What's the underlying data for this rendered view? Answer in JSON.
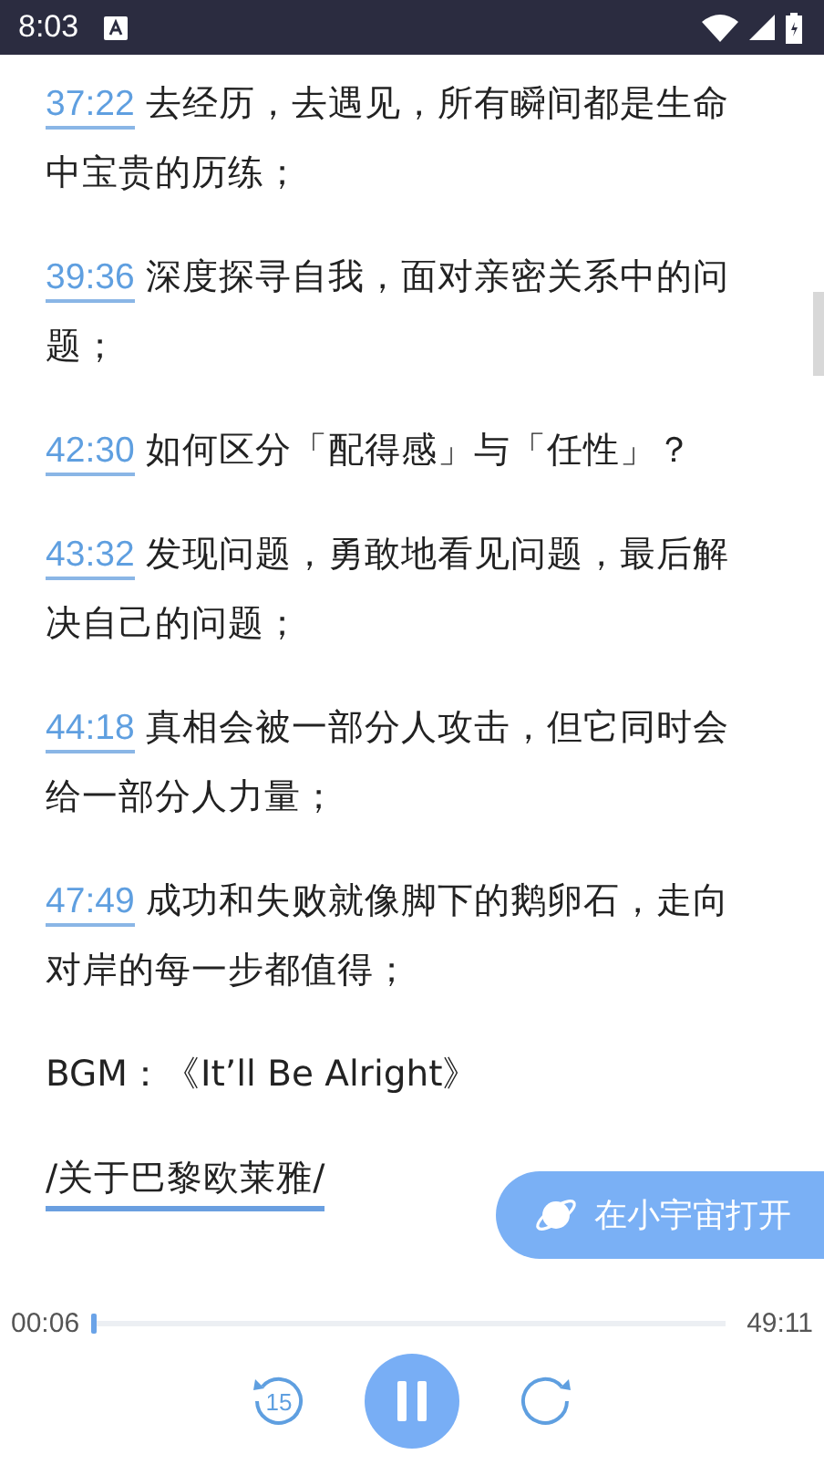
{
  "status_bar": {
    "time": "8:03"
  },
  "entries": [
    {
      "kind": "timestamp",
      "time": "37:22",
      "text": "去经历，去遇见，所有瞬间都是生命中宝贵的历练；"
    },
    {
      "kind": "timestamp",
      "time": "39:36",
      "text": "深度探寻自我，面对亲密关系中的问题；"
    },
    {
      "kind": "timestamp",
      "time": "42:30",
      "text": "如何区分「配得感」与「任性」？"
    },
    {
      "kind": "timestamp",
      "time": "43:32",
      "text": "发现问题，勇敢地看见问题，最后解决自己的问题；"
    },
    {
      "kind": "timestamp",
      "time": "44:18",
      "text": "真相会被一部分人攻击，但它同时会给一部分人力量；"
    },
    {
      "kind": "timestamp",
      "time": "47:49",
      "text": "成功和失败就像脚下的鹅卵石，走向对岸的每一步都值得；"
    },
    {
      "kind": "plain",
      "text": "BGM：《It’ll Be Alright》"
    },
    {
      "kind": "link",
      "text": "/关于巴黎欧莱雅/"
    }
  ],
  "open_button": {
    "label": "在小宇宙打开"
  },
  "player": {
    "elapsed": "00:06",
    "duration": "49:11",
    "level": 0.004,
    "playing": true,
    "rewind": "15"
  }
}
